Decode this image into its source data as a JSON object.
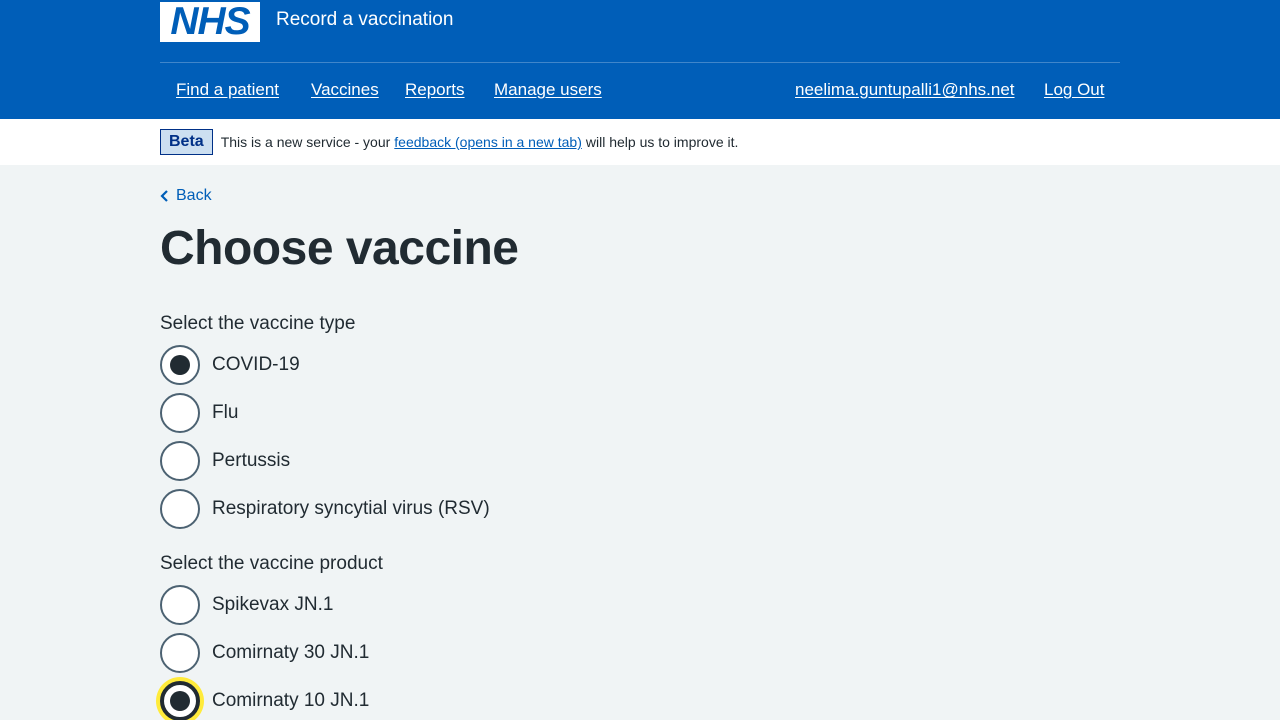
{
  "header": {
    "logo_text": "NHS",
    "service_name": "Record a vaccination",
    "nav_left": [
      "Find a patient",
      "Vaccines",
      "Reports",
      "Manage users"
    ],
    "user_email": "neelima.guntupalli1@nhs.net",
    "logout_label": "Log Out"
  },
  "beta_banner": {
    "tag": "Beta",
    "text_before": "This is a new service - your",
    "link_text": "feedback (opens in a new tab)",
    "text_after": "will help us to improve it."
  },
  "main": {
    "back_label": "Back",
    "title": "Choose vaccine",
    "vaccine_type": {
      "legend": "Select the vaccine type",
      "options": [
        {
          "label": "COVID-19",
          "checked": true
        },
        {
          "label": "Flu",
          "checked": false
        },
        {
          "label": "Pertussis",
          "checked": false
        },
        {
          "label": "Respiratory syncytial virus (RSV)",
          "checked": false
        }
      ]
    },
    "vaccine_product": {
      "legend": "Select the vaccine product",
      "options": [
        {
          "label": "Spikevax JN.1",
          "checked": false
        },
        {
          "label": "Comirnaty 30 JN.1",
          "checked": false
        },
        {
          "label": "Comirnaty 10 JN.1",
          "checked": true,
          "focused": true
        }
      ]
    }
  },
  "colors": {
    "nhs_blue": "#005eb8",
    "text": "#212b32",
    "background": "#f0f4f5",
    "focus_yellow": "#ffeb3b"
  }
}
